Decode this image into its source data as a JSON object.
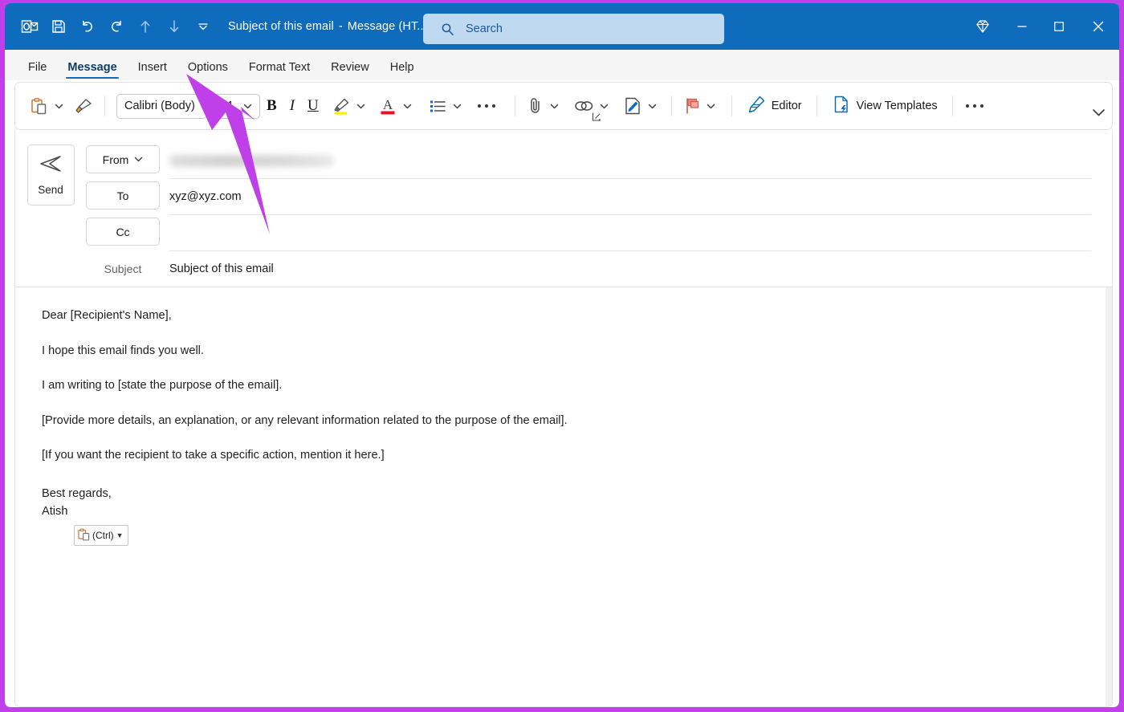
{
  "theme": {
    "titlebar_bg": "#0f6cbd",
    "accent": "#0f6cbd",
    "annotation_color": "#bf3fe8",
    "ribbon_bg": "#ffffff",
    "tabstrip_bg": "#f5f5f5"
  },
  "titlebar": {
    "app_icon": "outlook-icon",
    "quick_access": [
      {
        "name": "save-button",
        "icon": "save-icon",
        "enabled": true
      },
      {
        "name": "undo-button",
        "icon": "undo-icon",
        "enabled": true
      },
      {
        "name": "redo-button",
        "icon": "redo-icon",
        "enabled": true
      },
      {
        "name": "previous-item-button",
        "icon": "arrow-up-icon",
        "enabled": false
      },
      {
        "name": "next-item-button",
        "icon": "arrow-down-icon",
        "enabled": false
      },
      {
        "name": "customize-quick-access-toolbar-button",
        "icon": "chevron-down-icon",
        "enabled": true
      }
    ],
    "document_title": "Subject of this email",
    "title_separator": "-",
    "document_type": "Message (HT...",
    "search": {
      "placeholder": "Search",
      "icon": "search-icon"
    },
    "window_controls": {
      "premium_label": "diamond-icon",
      "minimize_label": "minimize-icon",
      "maximize_label": "maximize-icon",
      "close_label": "close-icon"
    }
  },
  "tabs": [
    {
      "label": "File",
      "active": false
    },
    {
      "label": "Message",
      "active": true
    },
    {
      "label": "Insert",
      "active": false
    },
    {
      "label": "Options",
      "active": false
    },
    {
      "label": "Format Text",
      "active": false
    },
    {
      "label": "Review",
      "active": false
    },
    {
      "label": "Help",
      "active": false
    }
  ],
  "ribbon": {
    "paste_icon": "paste-clipboard-icon",
    "paste_dropdown": "chevron-down-icon",
    "format_painter_icon": "format-painter-icon",
    "font_name": "Calibri (Body)",
    "font_size": "11",
    "bold_label": "B",
    "italic_label": "I",
    "underline_label": "U",
    "highlight_icon": "text-highlight-icon",
    "font_color_icon": "font-color-icon",
    "font_color_swatch": "#e81123",
    "highlight_swatch": "#ffec00",
    "bullets_icon": "bullet-list-icon",
    "more_formatting_icon": "more-options-ellipsis",
    "dialog_launcher_icon": "dialog-box-launcher-icon",
    "attach_icon": "attach-file-icon",
    "link_icon": "insert-link-icon",
    "signature_icon": "signature-icon",
    "flag_icon": "follow-up-flag-icon",
    "editor_label": "Editor",
    "editor_icon": "editor-pen-icon",
    "view_templates_label": "View Templates",
    "view_templates_icon": "templates-document-icon",
    "overflow_icon": "more-commands-ellipsis",
    "collapse_icon": "ribbon-display-options-chevron"
  },
  "compose": {
    "send_button": {
      "label": "Send",
      "icon": "send-paper-plane-icon"
    },
    "from": {
      "label": "From",
      "dropdown_icon": "chevron-down-icon",
      "value": "",
      "redacted": true
    },
    "to": {
      "label": "To",
      "value": "xyz@xyz.com"
    },
    "cc": {
      "label": "Cc",
      "value": ""
    },
    "subject": {
      "label": "Subject",
      "value": "Subject of this email"
    }
  },
  "message_body": {
    "paragraphs": [
      "Dear [Recipient's Name],",
      "I hope this email finds you well.",
      "I am writing to [state the purpose of the email].",
      "[Provide more details, an explanation, or any relevant information related to the purpose of the email].",
      "[If you want the recipient to take a specific action, mention it here.]"
    ],
    "closing_line_1": "Best regards,",
    "closing_line_2": "Atish",
    "paste_options": {
      "label": "(Ctrl)",
      "icon": "paste-clipboard-icon",
      "caret_icon": "caret-down-icon"
    }
  },
  "annotation": {
    "type": "arrow",
    "color": "#bf3fe8",
    "points_at": "Options"
  }
}
